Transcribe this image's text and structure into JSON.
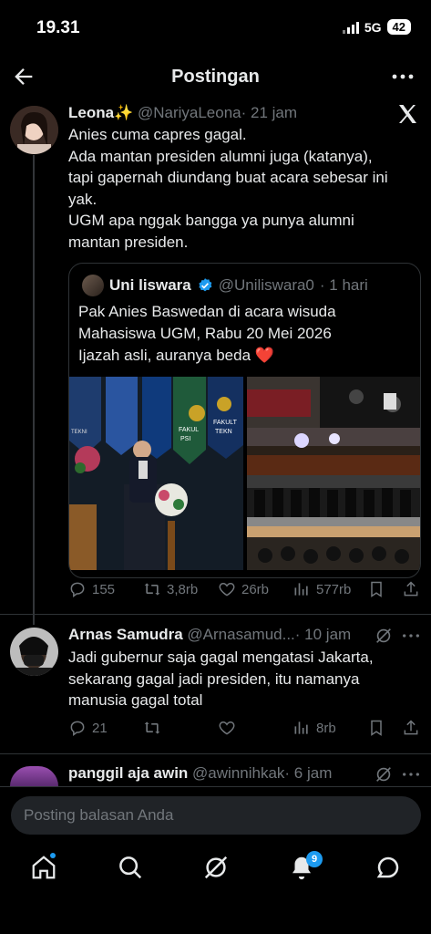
{
  "status": {
    "time": "19.31",
    "network": "5G",
    "battery": "42"
  },
  "header": {
    "title": "Postingan"
  },
  "main_post": {
    "name": "Leona✨",
    "handle": "@NariyaLeona",
    "time": "· 21 jam",
    "lines": [
      "Anies cuma capres gagal.",
      "Ada mantan presiden alumni juga (katanya),",
      "tapi gapernah diundang buat acara sebesar ini",
      "yak.",
      "UGM apa nggak bangga ya punya alumni",
      "mantan presiden."
    ]
  },
  "quote": {
    "name": "Uni liswara",
    "handle": "@Uniliswara0",
    "time": "· 1 hari",
    "lines": [
      "Pak Anies Baswedan di acara wisuda",
      "Mahasiswa UGM, Rabu 20 Mei 2026",
      "Ijazah asli, auranya beda ❤️"
    ],
    "banner_text": [
      "FAKUL",
      "PSI",
      "FAKULT",
      "TEKN",
      "TEKNI"
    ]
  },
  "main_actions": {
    "replies": "155",
    "reposts": "3,8rb",
    "likes": "26rb",
    "views": "577rb"
  },
  "reply1": {
    "name": "Arnas Samudra",
    "handle": "@Arnasamud...",
    "time": "· 10 jam",
    "lines": [
      "Jadi gubernur saja gagal mengatasi Jakarta,",
      "sekarang gagal jadi presiden, itu namanya",
      "manusia gagal total"
    ],
    "actions": {
      "replies": "21",
      "views": "8rb"
    }
  },
  "reply2": {
    "name": "panggil aja awin",
    "handle": "@awinnihkak",
    "time": "· 6 jam"
  },
  "reply_box": {
    "placeholder": "Posting balasan Anda"
  },
  "nav": {
    "notifications_badge": "9"
  },
  "colors": {
    "accent": "#1d9bf0",
    "background": "#000000",
    "muted": "#71767b",
    "heart": "#e0245e"
  }
}
